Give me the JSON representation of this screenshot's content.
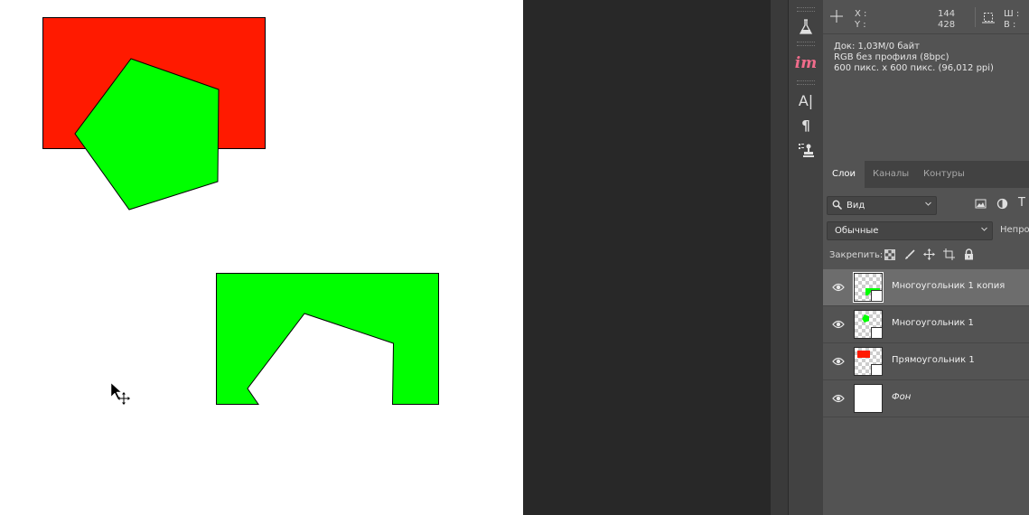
{
  "canvas": {
    "shapes": {
      "rectangle_color": "#ff1a00",
      "pentagon_color": "#00ff00",
      "polygon_copy_color": "#00ff00"
    }
  },
  "info": {
    "x_label": "X :",
    "y_label": "Y :",
    "x_value": "144",
    "y_value": "428",
    "w_label": "Ш :",
    "h_label": "В :",
    "doc_size": "Док: 1,03M/0 байт",
    "color_profile": "RGB без профиля (8bpc)",
    "dimensions": "600 пикс. x 600 пикс. (96,012 ppi)"
  },
  "toolstrip": {
    "im_label": "im",
    "char_icon": "A|",
    "para_icon": "¶"
  },
  "layers_panel": {
    "tabs": [
      {
        "label": "Слои",
        "active": true
      },
      {
        "label": "Каналы",
        "active": false
      },
      {
        "label": "Контуры",
        "active": false
      }
    ],
    "filter_label": "Вид",
    "blend_mode": "Обычные",
    "opacity_label": "Непрозр",
    "lock_label": "Закрепить:",
    "layers": [
      {
        "name": "Многоугольник 1 копия",
        "selected": true,
        "italic": false
      },
      {
        "name": "Многоугольник 1",
        "selected": false,
        "italic": false
      },
      {
        "name": "Прямоугольник 1",
        "selected": false,
        "italic": false
      },
      {
        "name": "Фон",
        "selected": false,
        "italic": true
      }
    ]
  }
}
